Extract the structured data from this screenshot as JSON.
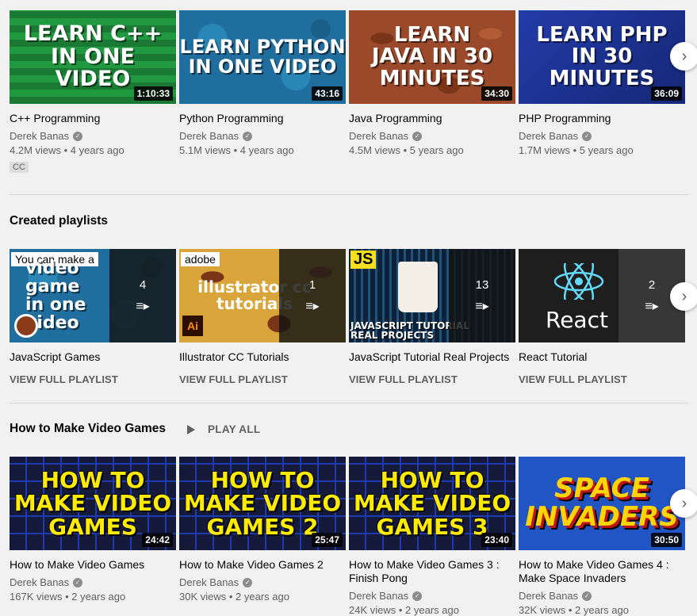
{
  "colors": {
    "accent": "#030303",
    "meta": "#606060",
    "bg": "#f1f1f1"
  },
  "videos_row": [
    {
      "thumb_text": "LEARN C++\nIN ONE VIDEO",
      "duration": "1:10:33",
      "title": "C++ Programming",
      "channel": "Derek Banas",
      "meta": "4.2M views • 4 years ago",
      "badge": "CC"
    },
    {
      "thumb_text": "LEARN PYTHON\nIN ONE VIDEO",
      "duration": "43:16",
      "title": "Python Programming",
      "channel": "Derek Banas",
      "meta": "5.1M views • 4 years ago"
    },
    {
      "thumb_text": "LEARN\nJAVA IN 30\nMINUTES",
      "duration": "34:30",
      "title": "Java Programming",
      "channel": "Derek Banas",
      "meta": "4.5M views • 5 years ago"
    },
    {
      "thumb_text": "LEARN PHP\nIN 30\nMINUTES",
      "duration": "36:09",
      "title": "PHP Programming",
      "channel": "Derek Banas",
      "meta": "1.7M views • 5 years ago"
    }
  ],
  "playlists_section": {
    "title": "Created playlists",
    "items": [
      {
        "thumb_text": "video game\nin one video",
        "tag": "You can make a",
        "count": "4",
        "title": "JavaScript Games",
        "action": "VIEW FULL PLAYLIST"
      },
      {
        "thumb_text": "illustrator cc\ntutorials",
        "tag": "adobe",
        "count": "1",
        "title": "Illustrator CC Tutorials",
        "action": "VIEW FULL PLAYLIST"
      },
      {
        "thumb_text": "JAVASCRIPT TUTORIAL\nREAL PROJECTS",
        "tag": "JS",
        "count": "13",
        "title": "JavaScript Tutorial Real Projects",
        "action": "VIEW FULL PLAYLIST"
      },
      {
        "thumb_text": "React",
        "tag": "",
        "count": "2",
        "title": "React Tutorial",
        "action": "VIEW FULL PLAYLIST"
      }
    ]
  },
  "games_section": {
    "title": "How to Make Video Games",
    "play_all": "PLAY ALL",
    "items": [
      {
        "thumb_text": "HOW TO\nMAKE VIDEO\nGAMES",
        "duration": "24:42",
        "title": "How to Make Video Games",
        "channel": "Derek Banas",
        "meta": "167K views • 2 years ago"
      },
      {
        "thumb_text": "HOW TO\nMAKE VIDEO\nGAMES 2",
        "duration": "25:47",
        "title": "How to Make Video Games 2",
        "channel": "Derek Banas",
        "meta": "30K views • 2 years ago"
      },
      {
        "thumb_text": "HOW TO\nMAKE VIDEO\nGAMES 3",
        "duration": "23:40",
        "title": "How to Make Video Games 3 : Finish Pong",
        "channel": "Derek Banas",
        "meta": "24K views • 2 years ago"
      },
      {
        "thumb_text": "SPACE\nINVADERS",
        "duration": "30:50",
        "title": "How to Make Video Games 4 : Make Space Invaders",
        "channel": "Derek Banas",
        "meta": "32K views • 2 years ago"
      }
    ]
  },
  "icons": {
    "next": "chevron-right-icon",
    "verified": "verified-check-icon",
    "playlist": "playlist-icon",
    "play": "play-icon"
  }
}
